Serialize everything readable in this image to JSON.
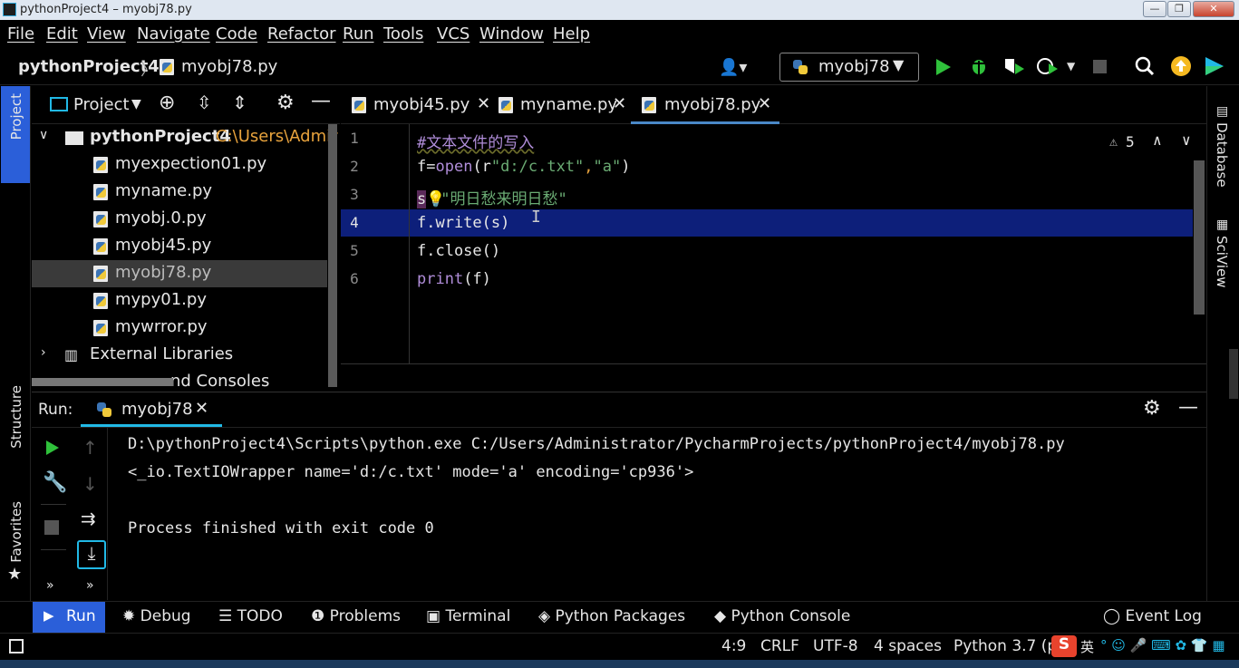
{
  "window": {
    "title": "pythonProject4 – myobj78.py"
  },
  "menu": [
    "File",
    "Edit",
    "View",
    "Navigate",
    "Code",
    "Refactor",
    "Run",
    "Tools",
    "VCS",
    "Window",
    "Help"
  ],
  "nav": {
    "project": "pythonProject4",
    "file": "myobj78.py"
  },
  "toolbar": {
    "run_config": "myobj78"
  },
  "left_stripe": {
    "project": "Project",
    "structure": "Structure",
    "favorites": "Favorites"
  },
  "project_panel": {
    "title": "Project",
    "root": {
      "name": "pythonProject4",
      "path": "C:\\Users\\Admir"
    },
    "files": [
      "myexpection01.py",
      "myname.py",
      "myobj.0.py",
      "myobj45.py",
      "myobj78.py",
      "mypy01.py",
      "mywrror.py"
    ],
    "selected": "myobj78.py",
    "external": "External Libraries",
    "scratches": "nd Consoles"
  },
  "editor": {
    "tabs": [
      "myobj45.py",
      "myname.py",
      "myobj78.py"
    ],
    "active_tab": "myobj78.py",
    "warnings": "5",
    "lines": [
      {
        "num": "1",
        "text": "#文本文件的写入"
      },
      {
        "num": "2",
        "p1": "f=",
        "p2": "open",
        "p3": "(r",
        "p4": "\"d:/c.txt\"",
        "p5": ",",
        "p6": "\"a\"",
        "p7": ")"
      },
      {
        "num": "3",
        "p1": "s",
        "p2": "\"明日愁来明日愁\""
      },
      {
        "num": "4",
        "text": "f.write(s)"
      },
      {
        "num": "5",
        "text": "f.close()"
      },
      {
        "num": "6",
        "p1": "print",
        "p2": "(f)"
      }
    ]
  },
  "right_stripe": {
    "database": "Database",
    "sciview": "SciView"
  },
  "run_panel": {
    "label": "Run:",
    "tab": "myobj78",
    "output": [
      "D:\\pythonProject4\\Scripts\\python.exe C:/Users/Administrator/PycharmProjects/pythonProject4/myobj78.py",
      "<_io.TextIOWrapper name='d:/c.txt' mode='a' encoding='cp936'>",
      "",
      "Process finished with exit code 0"
    ]
  },
  "bottom_tools": [
    "Run",
    "Debug",
    "TODO",
    "Problems",
    "Terminal",
    "Python Packages",
    "Python Console",
    "Event Log"
  ],
  "status": {
    "position": "4:9",
    "line_sep": "CRLF",
    "encoding": "UTF-8",
    "indent": "4 spaces",
    "interpreter": "Python 3.7 (p",
    "ime": "英"
  },
  "colors": {
    "accent": "#2b5fd9",
    "run_green": "#2fc13b",
    "highlight_line": "#0d1f7a",
    "string": "#6aab73",
    "keyword": "#b08dd9"
  }
}
